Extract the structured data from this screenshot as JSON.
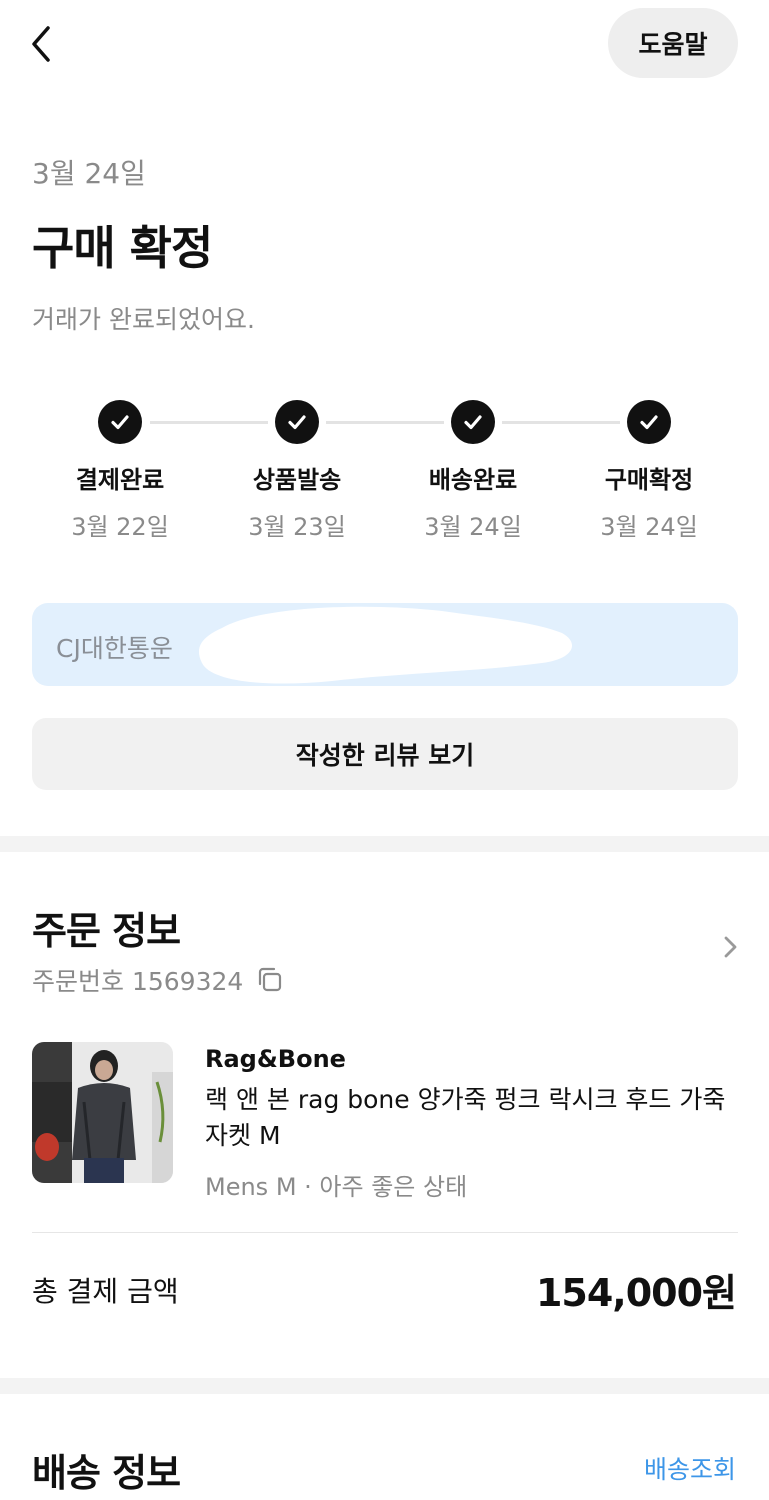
{
  "header": {
    "help_label": "도움말"
  },
  "status": {
    "date": "3월 24일",
    "title": "구매 확정",
    "subtitle": "거래가 완료되었어요."
  },
  "steps": [
    {
      "label": "결제완료",
      "date": "3월 22일"
    },
    {
      "label": "상품발송",
      "date": "3월 23일"
    },
    {
      "label": "배송완료",
      "date": "3월 24일"
    },
    {
      "label": "구매확정",
      "date": "3월 24일"
    }
  ],
  "courier": {
    "text": "CJ대한통운"
  },
  "review_button": "작성한 리뷰 보기",
  "order": {
    "title": "주문 정보",
    "order_number": "주문번호 1569324",
    "product": {
      "brand": "Rag&Bone",
      "name": "랙 앤 본 rag bone 양가죽 펑크 락시크 후드 가죽자켓 M",
      "meta": "Mens M · 아주 좋은 상태"
    },
    "total_label": "총 결제 금액",
    "total_amount": "154,000원"
  },
  "shipping": {
    "title": "배송 정보",
    "track_label": "배송조회"
  },
  "colors": {
    "accent_blue": "#3d96e8",
    "courier_bg": "#e2f0fd",
    "step_done": "#111111"
  },
  "icons": [
    "back-arrow-icon",
    "check-icon",
    "chevron-right-icon",
    "copy-icon"
  ]
}
